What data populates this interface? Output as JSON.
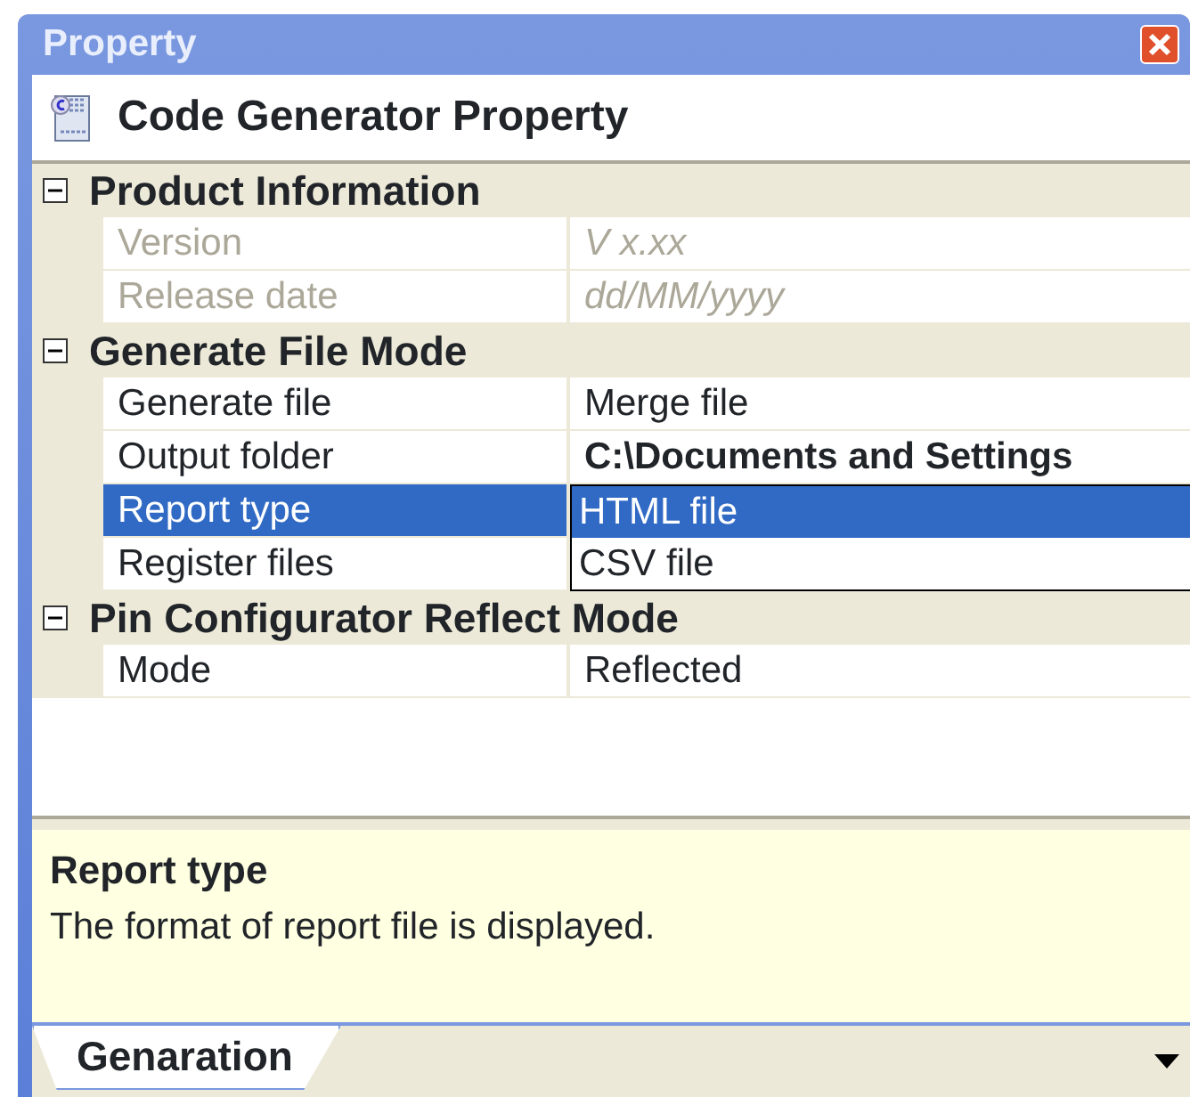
{
  "window": {
    "title": "Property"
  },
  "header": {
    "title": "Code Generator Property"
  },
  "categories": [
    {
      "name": "Product Information",
      "expanded": true,
      "rows": [
        {
          "name": "Version",
          "value": "V x.xx",
          "disabled": true,
          "selected": false,
          "emphasized": false
        },
        {
          "name": "Release date",
          "value": "dd/MM/yyyy",
          "disabled": true,
          "selected": false,
          "emphasized": false
        }
      ]
    },
    {
      "name": "Generate File Mode",
      "expanded": true,
      "rows": [
        {
          "name": "Generate file",
          "value": "Merge file",
          "disabled": false,
          "selected": false,
          "emphasized": false
        },
        {
          "name": "Output folder",
          "value": "C:\\Documents and Settings",
          "disabled": false,
          "selected": false,
          "emphasized": true
        },
        {
          "name": "Report type",
          "disabled": false,
          "selected": true,
          "dropdown": [
            {
              "label": "HTML file",
              "selected": true
            },
            {
              "label": "CSV file",
              "selected": false
            }
          ]
        },
        {
          "name": "Register files",
          "disabled": false,
          "selected": false
        }
      ]
    },
    {
      "name": "Pin Configurator Reflect Mode",
      "expanded": true,
      "rows": [
        {
          "name": "Mode",
          "value": "Reflected",
          "disabled": false,
          "selected": false,
          "emphasized": false
        }
      ]
    }
  ],
  "description": {
    "title": "Report type",
    "text": "The format of report file is displayed."
  },
  "tabs": [
    {
      "label": "Genaration",
      "selected": true
    }
  ]
}
